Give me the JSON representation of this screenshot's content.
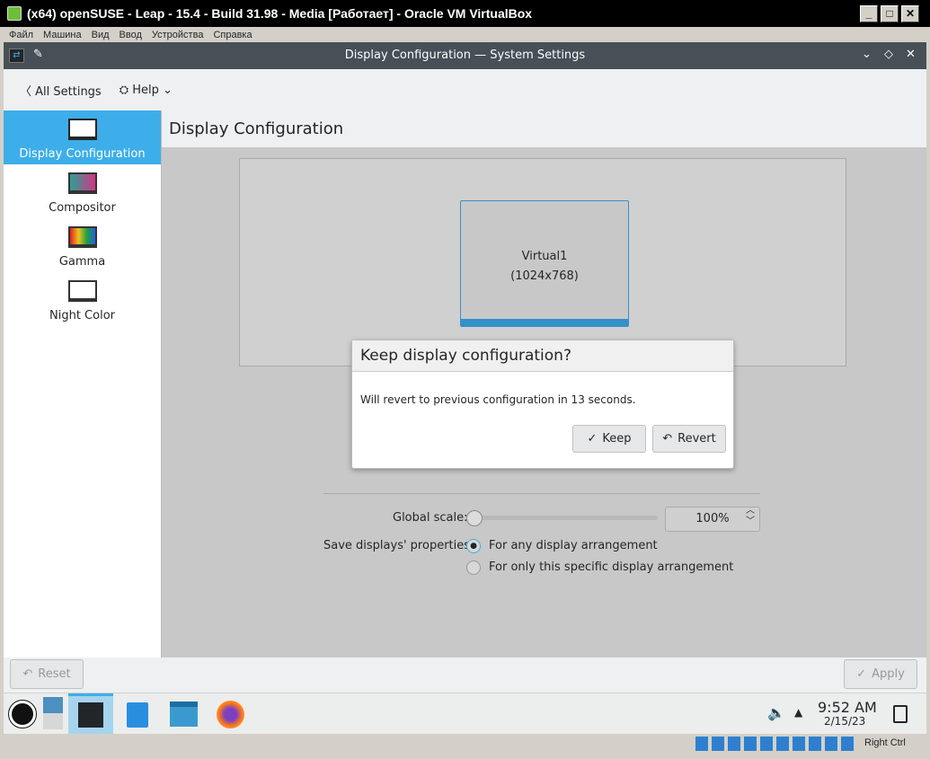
{
  "vbox": {
    "title": "(x64) openSUSE - Leap - 15.4 - Build 31.98 - Media [Работает] - Oracle VM VirtualBox",
    "menu": [
      "Файл",
      "Машина",
      "Вид",
      "Ввод",
      "Устройства",
      "Справка"
    ],
    "host_key": "Right Ctrl"
  },
  "window": {
    "title": "Display Configuration — System Settings"
  },
  "toolbar": {
    "back": "All Settings",
    "help": "Help"
  },
  "sidebar": {
    "items": [
      {
        "label": "Display Configuration"
      },
      {
        "label": "Compositor"
      },
      {
        "label": "Gamma"
      },
      {
        "label": "Night Color"
      }
    ]
  },
  "main": {
    "title": "Display Configuration",
    "output": {
      "name": "Virtual1",
      "resolution": "(1024x768)"
    },
    "global_scale_label": "Global scale:",
    "global_scale_value": "100%",
    "global_scale_fraction": 0,
    "save_label": "Save displays' properties:",
    "options": [
      "For any display arrangement",
      "For only this specific display arrangement"
    ],
    "selected_option": 0
  },
  "dialog": {
    "title": "Keep display configuration?",
    "message": "Will revert to previous configuration in 13 seconds.",
    "keep": "Keep",
    "revert": "Revert"
  },
  "footer": {
    "reset": "Reset",
    "apply": "Apply"
  },
  "taskbar": {
    "time": "9:52 AM",
    "date": "2/15/23"
  },
  "colors": {
    "accent": "#3daee9"
  }
}
